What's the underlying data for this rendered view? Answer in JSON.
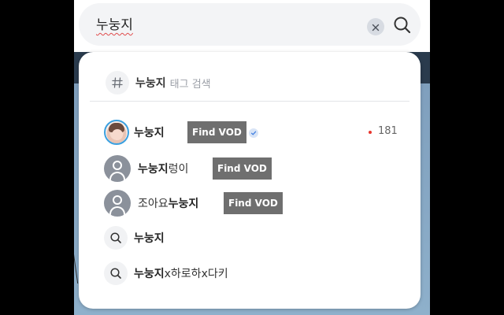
{
  "search": {
    "value": "누눙지",
    "clear_icon": "close-icon",
    "submit_icon": "search-icon"
  },
  "tag_search": {
    "icon": "hash-icon",
    "keyword": "누눙지",
    "suffix": "태그 검색"
  },
  "results": [
    {
      "type": "streamer-live",
      "avatar": "profile-photo",
      "name_bold": "누눙지",
      "name_rest": "",
      "badge": "Find VOD",
      "verified_icon": "check-icon",
      "viewer_count": "181"
    },
    {
      "type": "streamer",
      "avatar": "default-user-icon",
      "name_prefix": "",
      "name_bold": "누눙지",
      "name_rest": "렁이",
      "badge": "Find VOD"
    },
    {
      "type": "streamer",
      "avatar": "default-user-icon",
      "name_prefix": "조아요",
      "name_bold": "누눙지",
      "name_rest": "",
      "badge": "Find VOD"
    },
    {
      "type": "keyword",
      "icon": "search-icon",
      "name_bold": "누눙지",
      "name_rest": ""
    },
    {
      "type": "keyword",
      "icon": "search-icon",
      "name_bold": "누눙지",
      "name_rest": "x하로하x다키"
    }
  ],
  "colors": {
    "live_ring": "#3aa0e0",
    "live_dot": "#e8352d",
    "badge_bg": "#6f6f6f"
  }
}
